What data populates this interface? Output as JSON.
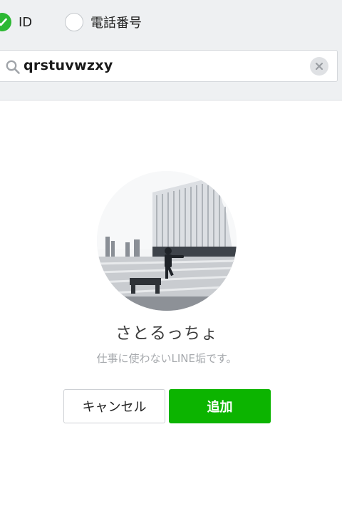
{
  "search_type": {
    "options": [
      {
        "label": "ID",
        "selected": true
      },
      {
        "label": "電話番号",
        "selected": false
      }
    ]
  },
  "search": {
    "value": "qrstuvwzxy",
    "icon": "search-icon",
    "clear_icon": "close-icon"
  },
  "profile": {
    "display_name": "さとるっちょ",
    "status_message": "仕事に使わないLINE垢です。"
  },
  "actions": {
    "cancel_label": "キャンセル",
    "add_label": "追加"
  },
  "colors": {
    "accent_green": "#0cb400",
    "radio_checked": "#2cb833",
    "panel_bg": "#eef0f2"
  }
}
